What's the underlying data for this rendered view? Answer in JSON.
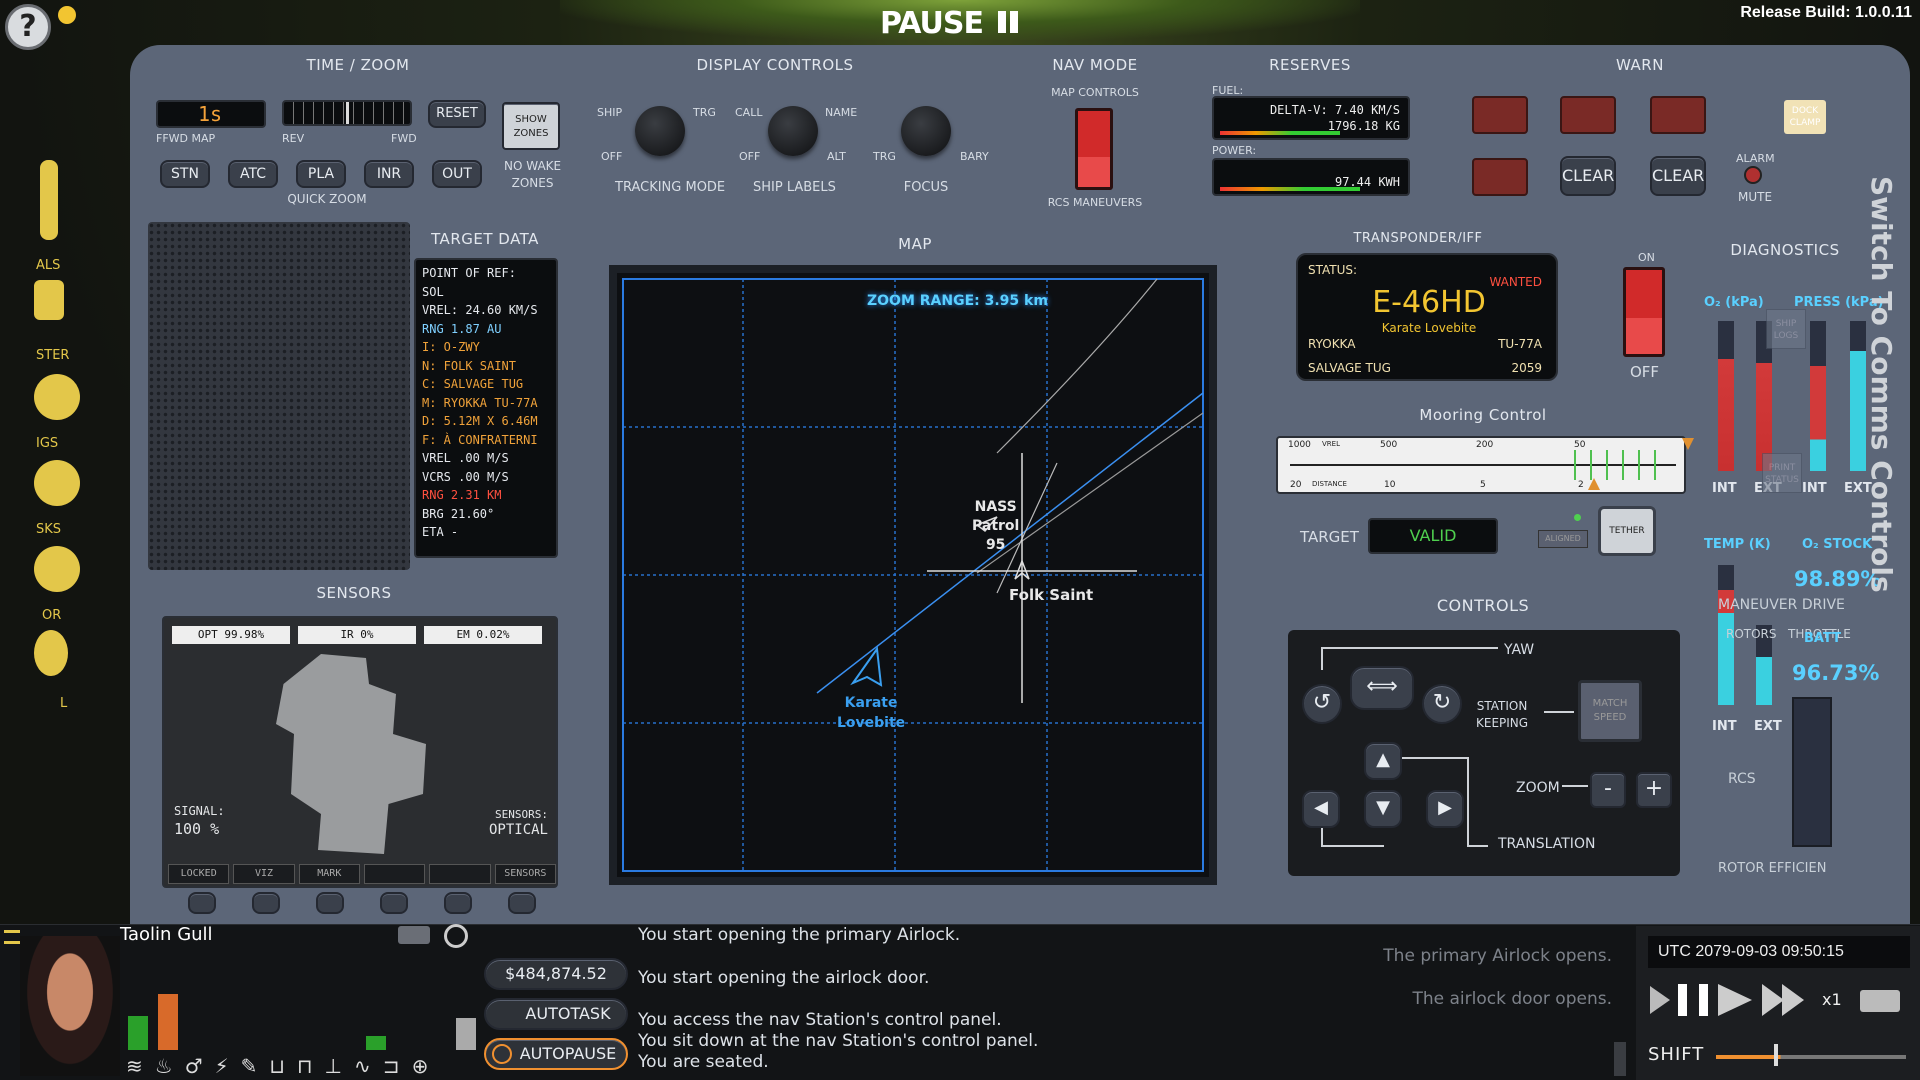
{
  "hud": {
    "pause_label": "PAUSE",
    "build": "Release Build: 1.0.0.11",
    "help": "?"
  },
  "time_zoom": {
    "title": "TIME / ZOOM",
    "readout": "1s",
    "ffwd_map": "FFWD MAP",
    "rev": "REV",
    "fwd": "FWD",
    "reset": "RESET",
    "show_zones_1": "SHOW",
    "show_zones_2": "ZONES",
    "no_wake_1": "NO WAKE",
    "no_wake_2": "ZONES",
    "quick_zoom": "QUICK ZOOM",
    "zoom_buttons": [
      "STN",
      "ATC",
      "PLA",
      "INR",
      "OUT"
    ]
  },
  "display_controls": {
    "title": "DISPLAY CONTROLS",
    "tracking": {
      "left": "SHIP",
      "right": "TRG",
      "off": "OFF",
      "label": "TRACKING MODE"
    },
    "ship_labels": {
      "left": "CALL",
      "right": "NAME",
      "off": "OFF",
      "alt": "ALT",
      "label": "SHIP LABELS"
    },
    "focus": {
      "left": "TRG",
      "right": "BARY",
      "label": "FOCUS"
    }
  },
  "nav_mode": {
    "title": "NAV MODE",
    "map_controls": "MAP CONTROLS",
    "rcs": "RCS MANEUVERS"
  },
  "reserves": {
    "title": "RESERVES",
    "fuel_label": "FUEL:",
    "dv": "DELTA-V: 7.40 KM/S",
    "fuel_kg": "1796.18 KG",
    "power_label": "POWER:",
    "power": "97.44 KWH"
  },
  "warn": {
    "title": "WARN",
    "clear1": "CLEAR",
    "clear2": "CLEAR",
    "alarm": "ALARM",
    "mute": "MUTE",
    "dock_1": "DOCK",
    "dock_2": "CLAMP"
  },
  "target_data": {
    "title": "TARGET DATA",
    "lines": [
      {
        "t": "POINT OF REF:",
        "c": "#e6e9ee"
      },
      {
        "t": "SOL",
        "c": "#e6e9ee"
      },
      {
        "t": "VREL: 24.60 KM/S",
        "c": "#e6e9ee"
      },
      {
        "t": "RNG 1.87 AU",
        "c": "#7fd0ff"
      },
      {
        "t": "I: O-ZWY",
        "c": "#f0a23a"
      },
      {
        "t": "N: FOLK SAINT",
        "c": "#f0a23a"
      },
      {
        "t": "C: SALVAGE TUG",
        "c": "#f0a23a"
      },
      {
        "t": "M: RYOKKA TU-77A",
        "c": "#f0a23a"
      },
      {
        "t": "D: 5.12M X 6.46M",
        "c": "#f0a23a"
      },
      {
        "t": "F: À CONFRATERNI",
        "c": "#f0a23a"
      },
      {
        "t": "VREL .00 M/S",
        "c": "#e6e9ee"
      },
      {
        "t": "VCRS .00 M/S",
        "c": "#e6e9ee"
      },
      {
        "t": "RNG 2.31 KM",
        "c": "#ff5040"
      },
      {
        "t": "BRG 21.60°",
        "c": "#e6e9ee"
      },
      {
        "t": "ETA -",
        "c": "#e6e9ee"
      }
    ]
  },
  "sensors": {
    "title": "SENSORS",
    "opt": "OPT 99.98%",
    "ir": "IR 0%",
    "em": "EM 0.02%",
    "signal_label": "SIGNAL:",
    "signal": "100 %",
    "sensors_label": "SENSORS:",
    "mode": "OPTICAL",
    "tabs": [
      "LOCKED",
      "VIZ",
      "MARK",
      "",
      "",
      "SENSORS"
    ]
  },
  "map": {
    "title": "MAP",
    "zoom_range": "ZOOM RANGE: 3.95 km",
    "nass_1": "NASS",
    "nass_2": "Patrol",
    "nass_3": "95",
    "folk": "Folk Saint",
    "karate_1": "Karate",
    "karate_2": "Lovebite"
  },
  "transponder": {
    "title": "TRANSPONDER/IFF",
    "status": "STATUS:",
    "wanted": "WANTED",
    "reg": "E-46HD",
    "name": "Karate Lovebite",
    "maker": "RYOKKA",
    "model": "TU-77A",
    "type": "SALVAGE TUG",
    "year": "2059",
    "on": "ON",
    "off": "OFF"
  },
  "mooring": {
    "title": "Mooring Control",
    "top_ticks": [
      "1000",
      "VREL",
      "500",
      "200",
      "50"
    ],
    "bottom_ticks": [
      "20",
      "DISTANCE",
      "10",
      "5",
      "2"
    ],
    "target_label": "TARGET",
    "valid": "VALID",
    "aligned": "ALIGNED",
    "tether": "TETHER"
  },
  "controls": {
    "title": "CONTROLS",
    "yaw": "YAW",
    "station_1": "STATION",
    "station_2": "KEEPING",
    "match_1": "MATCH",
    "match_2": "SPEED",
    "zoom": "ZOOM",
    "minus": "-",
    "plus": "+",
    "translation": "TRANSLATION"
  },
  "diagnostics": {
    "title": "DIAGNOSTICS",
    "o2": "O₂ (kPa)",
    "press": "PRESS (kPa)",
    "int": "INT",
    "ext": "EXT",
    "temp": "TEMP (K)",
    "o2stock": "O₂ STOCK",
    "o2pct": "98.89%",
    "maneuver": "MANEUVER DRIVE",
    "rotors": "ROTORS",
    "throttle": "THROTTLE",
    "batt": "BATT",
    "battpct": "96.73%",
    "rcs": "RCS",
    "rotor_eff": "ROTOR EFFICIEN",
    "ship_logs_1": "SHIP",
    "ship_logs_2": "LOGS",
    "print_1": "PRINT",
    "print_2": "STATUS",
    "o2_int": 0.75,
    "o2_ext": 0.72,
    "press_int": 0.7,
    "press_ext": 0.8,
    "temp_int": 0.82,
    "temp_ext": 0.6
  },
  "vertical_text": "Switch To Comms Controls",
  "sidebar": {
    "labels": [
      "ALS",
      "STER",
      "IGS",
      "SKS",
      "OR",
      "L"
    ]
  },
  "character": {
    "name": "Taolin Gull",
    "money": "$484,874.52",
    "autotask": "AUTOTASK",
    "autopause": "AUTOPAUSE"
  },
  "log": {
    "lines": [
      "You start opening the primary Airlock.",
      "You start opening the airlock door.",
      "You access the nav Station's control panel.",
      "You sit down at the nav Station's control panel.",
      "You are seated."
    ],
    "faded": [
      "The primary Airlock opens.",
      "The airlock door opens."
    ]
  },
  "time": {
    "utc": "UTC 2079-09-03 09:50:15",
    "speed": "x1",
    "shift": "SHIFT"
  }
}
